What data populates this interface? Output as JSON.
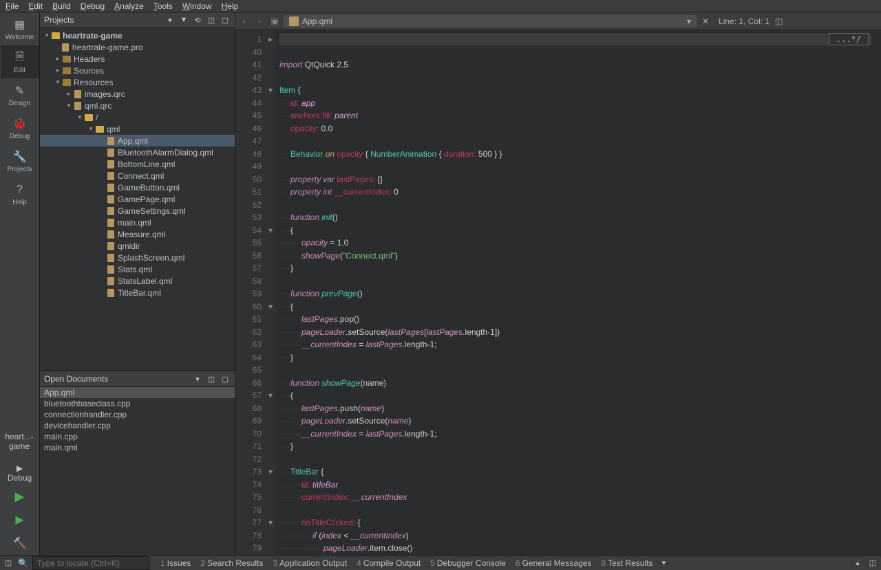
{
  "menubar": [
    "File",
    "Edit",
    "Build",
    "Debug",
    "Analyze",
    "Tools",
    "Window",
    "Help"
  ],
  "rail": [
    {
      "label": "Welcome",
      "name": "welcome"
    },
    {
      "label": "Edit",
      "name": "edit",
      "active": true
    },
    {
      "label": "Design",
      "name": "design"
    },
    {
      "label": "Debug",
      "name": "debug"
    },
    {
      "label": "Projects",
      "name": "projects"
    },
    {
      "label": "Help",
      "name": "help"
    }
  ],
  "kit": {
    "project": "heart...-game",
    "mode": "Debug"
  },
  "projects_panel": {
    "title": "Projects"
  },
  "project_tree": {
    "root": "heartrate-game",
    "pro": "heartrate-game.pro",
    "headers": "Headers",
    "sources": "Sources",
    "resources": "Resources",
    "images": "images.qrc",
    "qmlqrc": "qml.qrc",
    "slash": "/",
    "qml": "qml",
    "files": [
      "App.qml",
      "BluetoothAlarmDialog.qml",
      "BottomLine.qml",
      "Connect.qml",
      "GameButton.qml",
      "GamePage.qml",
      "GameSettings.qml",
      "main.qml",
      "Measure.qml",
      "qmldir",
      "SplashScreen.qml",
      "Stats.qml",
      "StatsLabel.qml",
      "TitleBar.qml"
    ]
  },
  "open_docs": {
    "title": "Open Documents",
    "items": [
      "App.qml",
      "bluetoothbaseclass.cpp",
      "connectionhandler.cpp",
      "devicehandler.cpp",
      "main.cpp",
      "main.qml"
    ]
  },
  "tab": {
    "file": "App.qml"
  },
  "cursor": "Line: 1, Col: 1",
  "collapsed": "...*/",
  "locator_placeholder": "Type to locate (Ctrl+K)",
  "status_tabs": [
    {
      "n": "1",
      "t": "Issues"
    },
    {
      "n": "2",
      "t": "Search Results"
    },
    {
      "n": "3",
      "t": "Application Output"
    },
    {
      "n": "4",
      "t": "Compile Output"
    },
    {
      "n": "5",
      "t": "Debugger Console"
    },
    {
      "n": "6",
      "t": "General Messages"
    },
    {
      "n": "8",
      "t": "Test Results"
    }
  ],
  "code": {
    "line_start": 1,
    "line_after_fold": 40
  }
}
